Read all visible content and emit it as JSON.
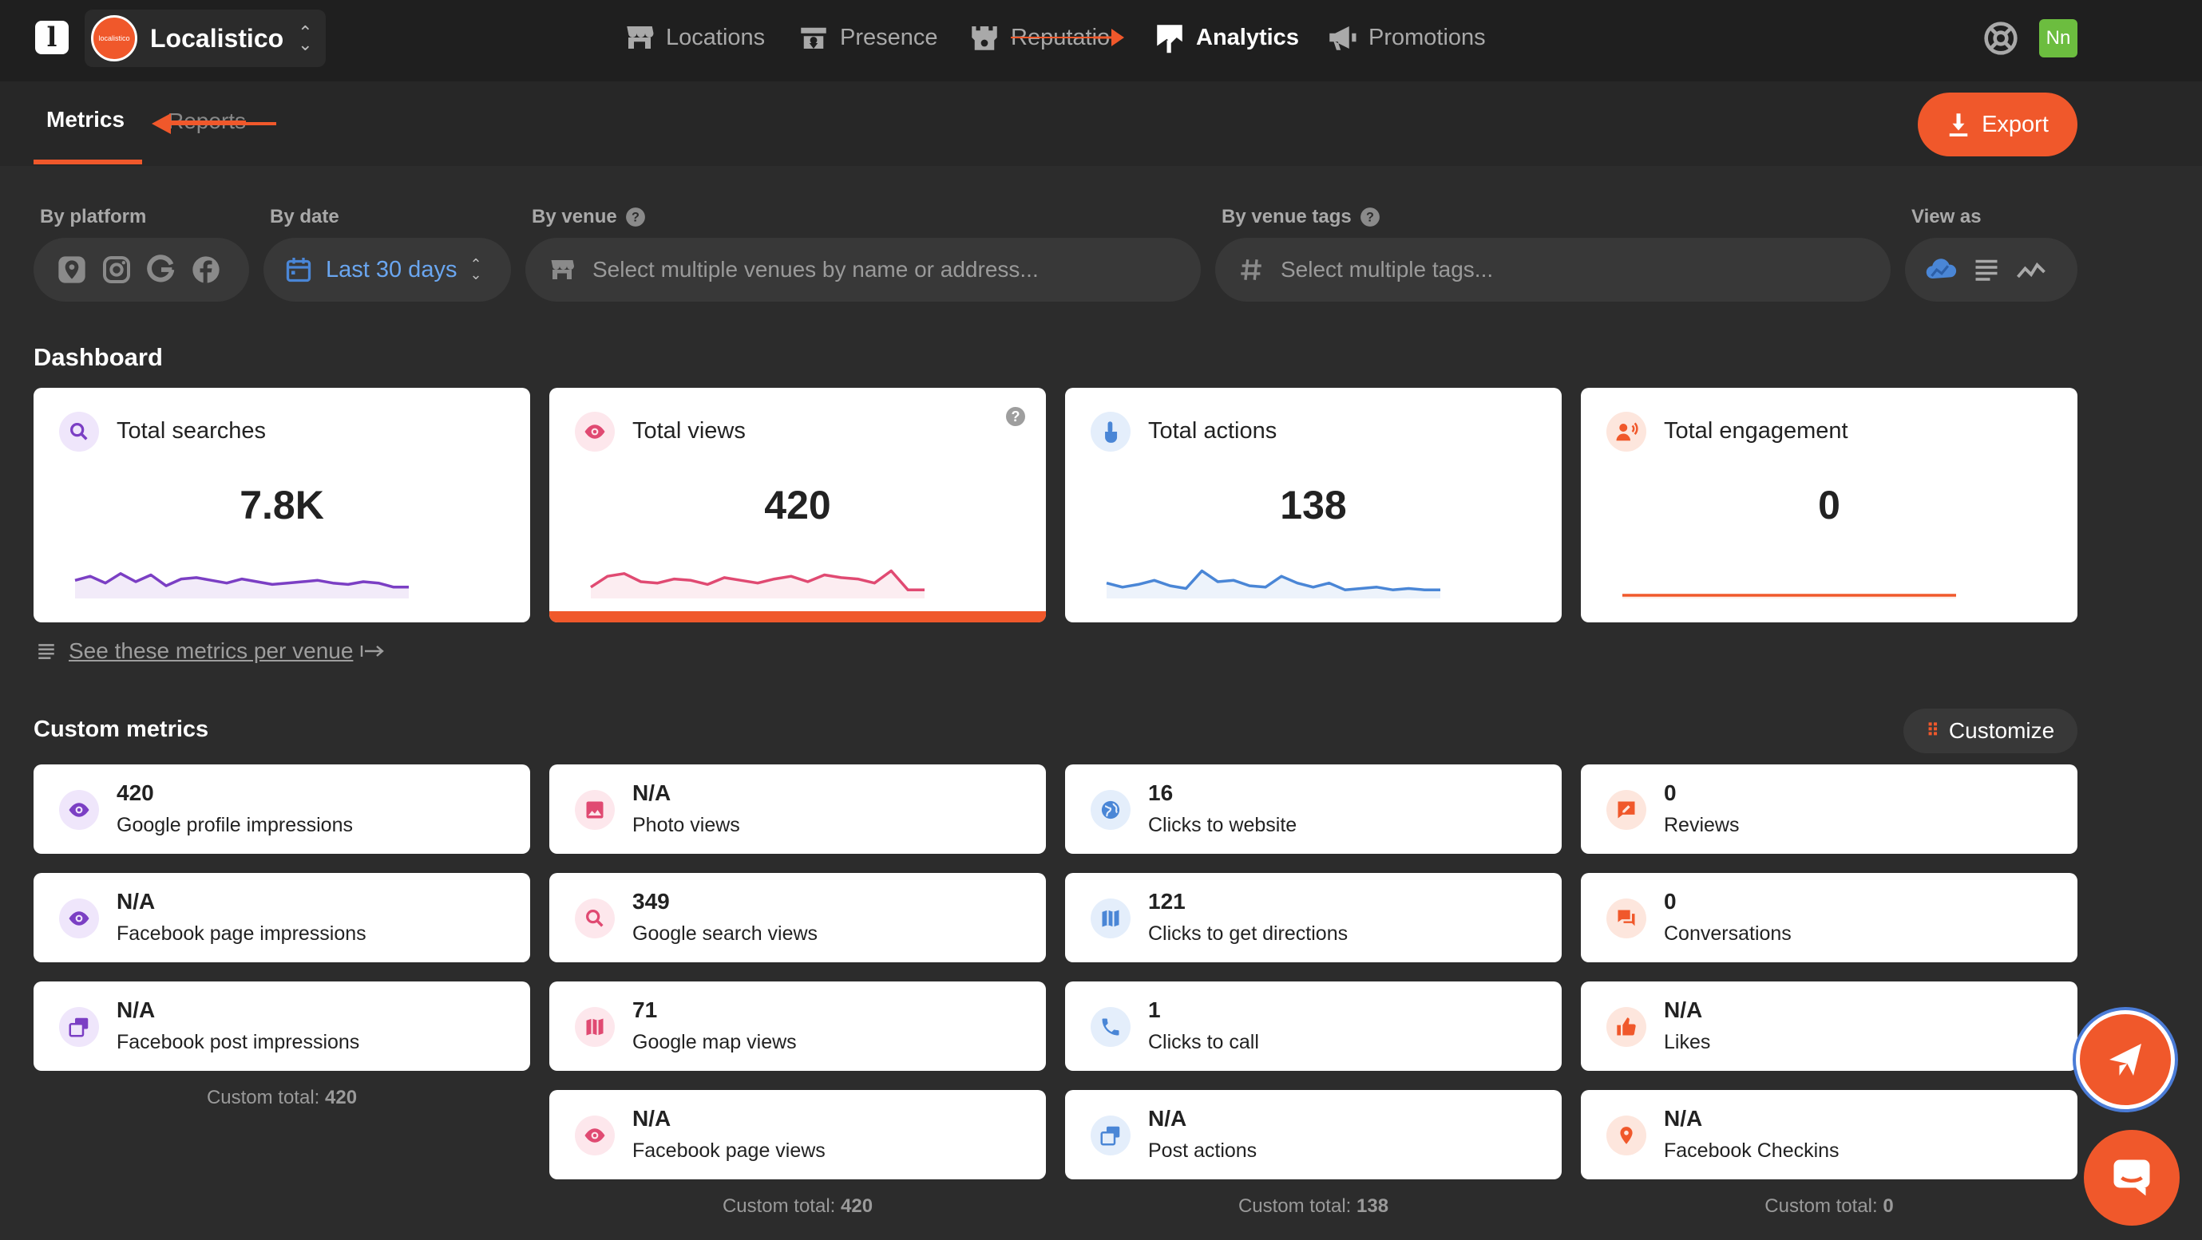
{
  "app": {
    "org_name": "Localistico",
    "org_avatar_text": "localistico",
    "user_initials": "Nn"
  },
  "nav": {
    "locations": "Locations",
    "presence": "Presence",
    "reputation": "Reputatio",
    "analytics": "Analytics",
    "promotions": "Promotions"
  },
  "tabs": {
    "metrics": "Metrics",
    "reports": "Reports"
  },
  "export_label": "Export",
  "filters": {
    "platform_label": "By platform",
    "date_label": "By date",
    "date_value": "Last 30 days",
    "venue_label": "By venue",
    "venue_placeholder": "Select multiple venues by name or address...",
    "tags_label": "By venue tags",
    "tags_placeholder": "Select multiple tags...",
    "view_label": "View as"
  },
  "dashboard": {
    "title": "Dashboard",
    "cards": [
      {
        "title": "Total searches",
        "value": "7.8K",
        "color": "#7b3fc4",
        "spark": [
          0.55,
          0.7,
          0.45,
          0.8,
          0.5,
          0.75,
          0.35,
          0.6,
          0.65,
          0.55,
          0.45,
          0.6,
          0.5,
          0.4,
          0.45,
          0.5,
          0.55,
          0.45,
          0.4,
          0.5,
          0.45,
          0.3,
          0.3
        ]
      },
      {
        "title": "Total views",
        "value": "420",
        "color": "#e04a72",
        "spark": [
          0.3,
          0.7,
          0.8,
          0.5,
          0.45,
          0.6,
          0.55,
          0.4,
          0.65,
          0.55,
          0.45,
          0.6,
          0.7,
          0.5,
          0.75,
          0.65,
          0.6,
          0.45,
          0.9,
          0.2,
          0.2
        ]
      },
      {
        "title": "Total actions",
        "value": "138",
        "color": "#4a86d6",
        "spark": [
          0.45,
          0.3,
          0.4,
          0.55,
          0.35,
          0.25,
          0.9,
          0.5,
          0.55,
          0.35,
          0.3,
          0.7,
          0.45,
          0.3,
          0.45,
          0.2,
          0.25,
          0.3,
          0.2,
          0.25,
          0.2,
          0.2
        ]
      },
      {
        "title": "Total engagement",
        "value": "0",
        "color": "#f0582b",
        "spark": [
          0,
          0,
          0,
          0,
          0,
          0,
          0,
          0,
          0,
          0
        ]
      }
    ]
  },
  "per_venue_link": "See these metrics per venue",
  "custom": {
    "title": "Custom metrics",
    "customize_label": "Customize",
    "columns": [
      {
        "items": [
          {
            "value": "420",
            "label": "Google profile impressions"
          },
          {
            "value": "N/A",
            "label": "Facebook page impressions"
          },
          {
            "value": "N/A",
            "label": "Facebook post impressions"
          }
        ],
        "total_prefix": "Custom total: ",
        "total_value": "420"
      },
      {
        "items": [
          {
            "value": "N/A",
            "label": "Photo views"
          },
          {
            "value": "349",
            "label": "Google search views"
          },
          {
            "value": "71",
            "label": "Google map views"
          },
          {
            "value": "N/A",
            "label": "Facebook page views"
          }
        ],
        "total_prefix": "Custom total: ",
        "total_value": "420"
      },
      {
        "items": [
          {
            "value": "16",
            "label": "Clicks to website"
          },
          {
            "value": "121",
            "label": "Clicks to get directions"
          },
          {
            "value": "1",
            "label": "Clicks to call"
          },
          {
            "value": "N/A",
            "label": "Post actions"
          }
        ],
        "total_prefix": "Custom total: ",
        "total_value": "138"
      },
      {
        "items": [
          {
            "value": "0",
            "label": "Reviews"
          },
          {
            "value": "0",
            "label": "Conversations"
          },
          {
            "value": "N/A",
            "label": "Likes"
          },
          {
            "value": "N/A",
            "label": "Facebook Checkins"
          }
        ],
        "total_prefix": "Custom total: ",
        "total_value": "0"
      }
    ]
  },
  "colors": {
    "accent": "#f0582b",
    "purple": "#7b3fc4",
    "pink": "#e04a72",
    "blue": "#4a86d6"
  }
}
